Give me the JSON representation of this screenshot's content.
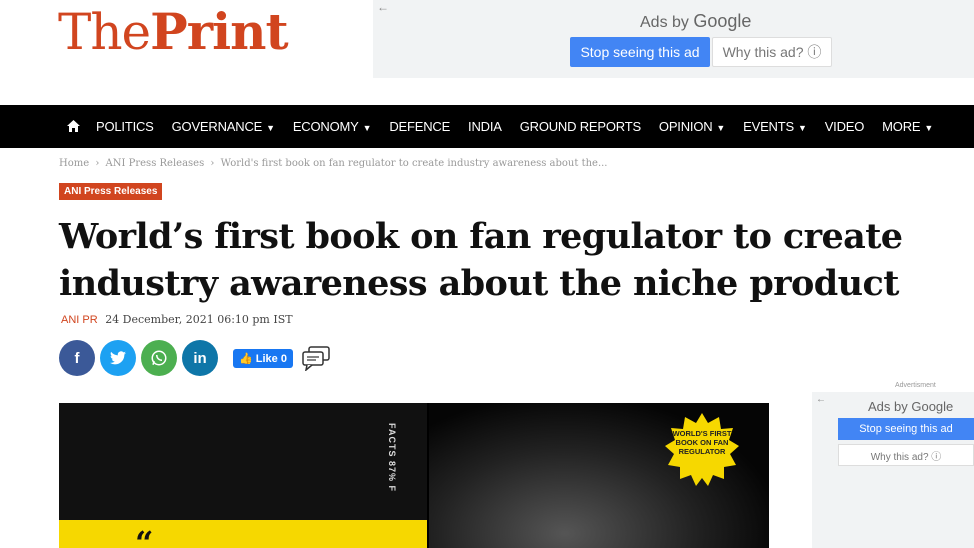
{
  "brand": {
    "part1": "The",
    "part2": "Print"
  },
  "top_ad": {
    "back": "←",
    "ads_by": "Ads by",
    "google": "Google",
    "stop": "Stop seeing this ad",
    "why": "Why this ad? ⓘ"
  },
  "nav": {
    "home_icon": "home-icon",
    "items": [
      {
        "label": "POLITICS",
        "chevron": ""
      },
      {
        "label": "GOVERNANCE",
        "chevron": "⌄"
      },
      {
        "label": "ECONOMY",
        "chevron": "⌄"
      },
      {
        "label": "DEFENCE",
        "chevron": ""
      },
      {
        "label": "INDIA",
        "chevron": ""
      },
      {
        "label": "GROUND REPORTS",
        "chevron": ""
      },
      {
        "label": "OPINION",
        "chevron": "⌄"
      },
      {
        "label": "EVENTS",
        "chevron": "⌄"
      },
      {
        "label": "VIDEO",
        "chevron": ""
      },
      {
        "label": "MORE",
        "chevron": "⌄"
      }
    ]
  },
  "breadcrumb": {
    "home": "Home",
    "sep": "›",
    "section": "ANI Press Releases",
    "current": "World's first book on fan regulator to create industry awareness about the..."
  },
  "category": "ANI Press Releases",
  "article": {
    "title": "World’s first book on fan regulator to create industry awareness about the niche product",
    "author": "ANI PR",
    "date": "24 December, 2021 06:10 pm IST"
  },
  "share": {
    "facebook": "f",
    "twitter": "🐦",
    "whatsapp": "✆",
    "linkedin": "in",
    "like": "👍 Like 0"
  },
  "image": {
    "quote_mark": "“",
    "vertical_text": "FACTS 87% F",
    "badge_text": "WORLD'S FIRST BOOK ON FAN REGULATOR"
  },
  "side_ad": {
    "label": "Advertisment",
    "back": "←",
    "ads_by": "Ads by Google",
    "stop": "Stop seeing this ad",
    "why": "Why this ad? ⓘ"
  }
}
